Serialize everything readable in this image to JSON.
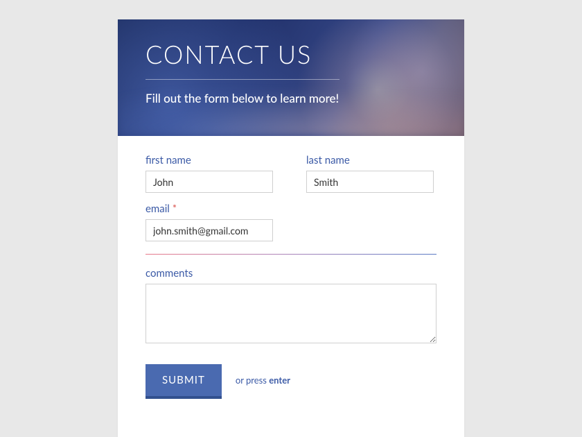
{
  "header": {
    "title": "CONTACT US",
    "subtitle": "Fill out the form below to learn more!"
  },
  "form": {
    "first_name": {
      "label": "first name",
      "value": "John"
    },
    "last_name": {
      "label": "last name",
      "value": "Smith"
    },
    "email": {
      "label": "email",
      "required_mark": "*",
      "value": "john.smith@gmail.com"
    },
    "comments": {
      "label": "comments",
      "value": ""
    }
  },
  "actions": {
    "submit_label": "SUBMIT",
    "hint_prefix": "or press ",
    "hint_key": "enter"
  },
  "colors": {
    "accent": "#3b5aa6",
    "button": "#4a6ab0",
    "button_shadow": "#32508e",
    "required": "#d9534f"
  }
}
